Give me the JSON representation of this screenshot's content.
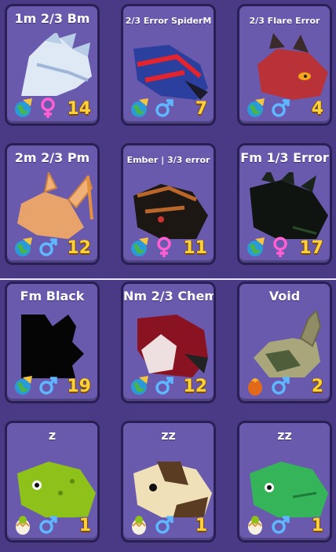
{
  "cards": [
    {
      "name": "1m 2/3 Bm",
      "small": false,
      "badge": "world-icon",
      "gender": "female",
      "count": "14",
      "art": "white-dragon"
    },
    {
      "name": "2/3 Error SpiderM",
      "small": true,
      "badge": "world-icon",
      "gender": "male",
      "count": "7",
      "art": "spider-dragon"
    },
    {
      "name": "2/3 Flare Error",
      "small": true,
      "badge": "world-icon",
      "gender": "male",
      "count": "4",
      "art": "red-dragon"
    },
    {
      "name": "2m 2/3 Pm",
      "small": false,
      "badge": "world-icon",
      "gender": "male",
      "count": "12",
      "art": "pink-dragon"
    },
    {
      "name": "Ember | 3/3 error",
      "small": true,
      "badge": "world-icon",
      "gender": "female",
      "count": "11",
      "art": "ember-dragon"
    },
    {
      "name": "Fm 1/3 Error",
      "small": false,
      "badge": "world-icon",
      "gender": "female",
      "count": "17",
      "art": "black-green-dragon"
    },
    {
      "name": "Fm Black",
      "small": false,
      "badge": "world-icon",
      "gender": "male",
      "count": "19",
      "art": "black-dragon"
    },
    {
      "name": "Nm 2/3 Chem",
      "small": false,
      "badge": "world-icon",
      "gender": "male",
      "count": "12",
      "art": "chem-dragon"
    },
    {
      "name": "Void",
      "small": false,
      "badge": "fire-egg-icon",
      "gender": "male",
      "count": "2",
      "art": "void-dragon"
    },
    {
      "name": "z",
      "small": false,
      "badge": "egg-icon",
      "gender": "male",
      "count": "1",
      "art": "lime-dragon"
    },
    {
      "name": "zz",
      "small": false,
      "badge": "egg-icon",
      "gender": "male",
      "count": "1",
      "art": "cream-dragon"
    },
    {
      "name": "zz",
      "small": false,
      "badge": "egg-icon",
      "gender": "male",
      "count": "1",
      "art": "green-dragon"
    }
  ],
  "colors": {
    "female": "#ff5fd2",
    "male": "#5fb8ff",
    "count": "#ffd23a"
  }
}
